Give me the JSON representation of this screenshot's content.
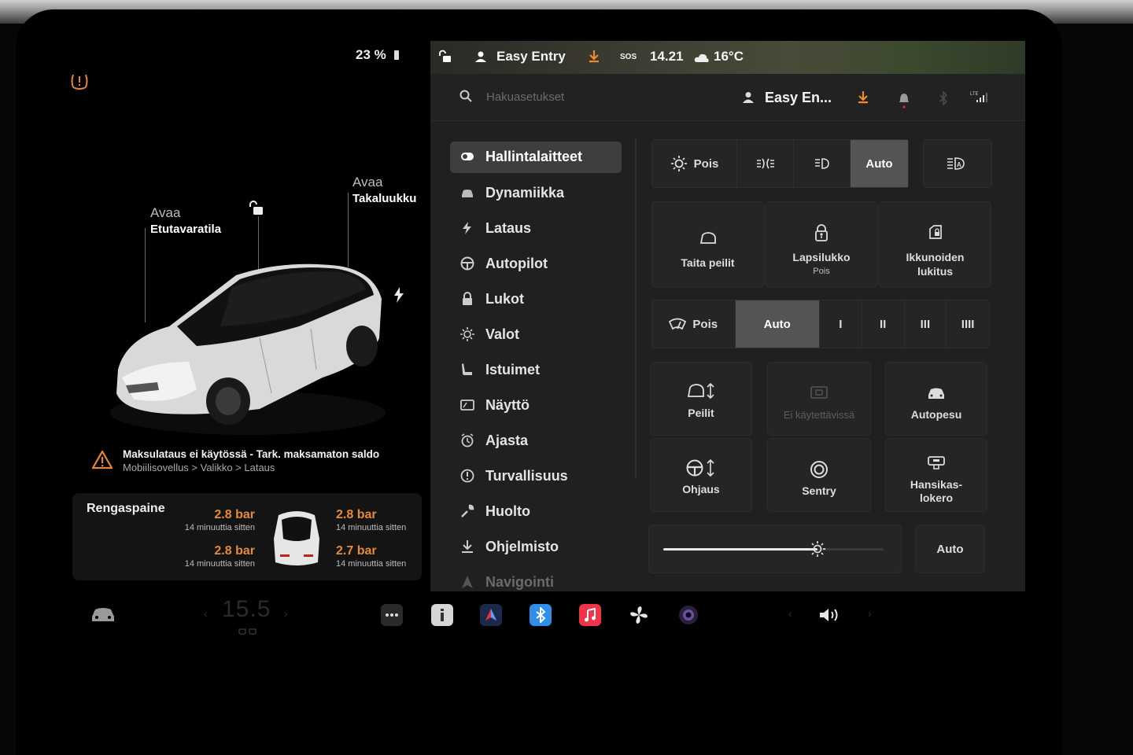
{
  "status": {
    "battery_percent": "23 %",
    "profile": "Easy Entry",
    "sos": "SOS",
    "time": "14.21",
    "temperature": "16°C"
  },
  "car": {
    "callout_frunk_l1": "Avaa",
    "callout_frunk_l2": "Etutavaratila",
    "callout_trunk_l1": "Avaa",
    "callout_trunk_l2": "Takaluukku"
  },
  "notice": {
    "title": "Maksulataus ei käytössä - Tark. maksamaton saldo",
    "subtitle": "Mobiilisovellus > Valikko > Lataus"
  },
  "tires": {
    "title": "Rengaspaine",
    "fl": {
      "value": "2.8 bar",
      "ago": "14 minuuttia sitten"
    },
    "fr": {
      "value": "2.8 bar",
      "ago": "14 minuuttia sitten"
    },
    "rl": {
      "value": "2.8 bar",
      "ago": "14 minuuttia sitten"
    },
    "rr": {
      "value": "2.7 bar",
      "ago": "14 minuuttia sitten"
    }
  },
  "topbar": {
    "search_placeholder": "Hakuasetukset",
    "profile_short": "Easy En..."
  },
  "menu": [
    {
      "label": "Hallintalaitteet",
      "icon": "toggle-icon",
      "active": true
    },
    {
      "label": "Dynamiikka",
      "icon": "car-icon"
    },
    {
      "label": "Lataus",
      "icon": "bolt-icon"
    },
    {
      "label": "Autopilot",
      "icon": "steering-wheel-icon"
    },
    {
      "label": "Lukot",
      "icon": "lock-icon"
    },
    {
      "label": "Valot",
      "icon": "sun-icon"
    },
    {
      "label": "Istuimet",
      "icon": "seat-icon"
    },
    {
      "label": "Näyttö",
      "icon": "display-icon"
    },
    {
      "label": "Ajasta",
      "icon": "alarm-clock-icon"
    },
    {
      "label": "Turvallisuus",
      "icon": "alert-circle-icon"
    },
    {
      "label": "Huolto",
      "icon": "wrench-icon"
    },
    {
      "label": "Ohjelmisto",
      "icon": "download-icon"
    },
    {
      "label": "Navigointi",
      "icon": "navigation-icon"
    }
  ],
  "controls": {
    "lights": {
      "off": "Pois",
      "auto": "Auto"
    },
    "mirrors_fold": "Taita peilit",
    "child_lock": {
      "label": "Lapsilukko",
      "state": "Pois"
    },
    "window_lock_l1": "Ikkunoiden",
    "window_lock_l2": "lukitus",
    "wipers": {
      "off": "Pois",
      "auto": "Auto",
      "speeds": [
        "I",
        "II",
        "III",
        "IIII"
      ]
    },
    "mirrors": "Peilit",
    "unavailable": "Ei käytettävissä",
    "car_wash": "Autopesu",
    "steering": "Ohjaus",
    "sentry": "Sentry",
    "glovebox_l1": "Hansikas-",
    "glovebox_l2": "lokero",
    "brightness_auto": "Auto",
    "brightness_level": 0.7
  },
  "dock": {
    "cabin_temp": "15.5",
    "apps": [
      "car-icon",
      "more-icon",
      "info-icon",
      "navigation-app-icon",
      "bluetooth-icon",
      "music-icon",
      "fan-icon",
      "camera-icon",
      "volume-icon"
    ]
  },
  "colors": {
    "accent_orange": "#e58a3b",
    "warning_orange": "#e8843a",
    "bluetooth_blue": "#2f8fe8",
    "music_red": "#f0344a"
  }
}
